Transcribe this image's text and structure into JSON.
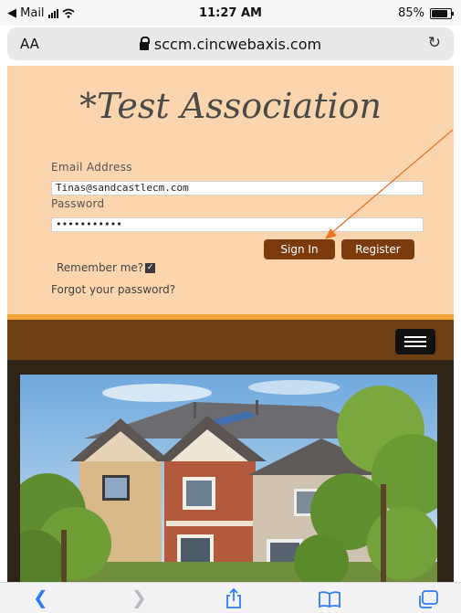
{
  "status_bar": {
    "back_app": "◀ Mail",
    "time": "11:27 AM",
    "battery": "85%",
    "battery_level": 0.85
  },
  "address_bar": {
    "text_size_label": "AA",
    "url": "sccm.cincwebaxis.com",
    "reload_icon": "reload-icon"
  },
  "login": {
    "site_title": "*Test Association",
    "email_label": "Email Address",
    "email_value": "Tinas@sandcastlecm.com",
    "password_label": "Password",
    "password_value": "•••••••••••",
    "sign_in_label": "Sign In",
    "register_label": "Register",
    "remember_label": "Remember me?",
    "remember_checked": true,
    "forgot_label": "Forgot your password?"
  },
  "nav": {
    "menu_icon": "hamburger-menu-icon"
  },
  "toolbar": {
    "back_icon": "chevron-left-icon",
    "forward_icon": "chevron-right-icon",
    "share_icon": "share-icon",
    "bookmarks_icon": "book-icon",
    "tabs_icon": "tabs-icon"
  },
  "colors": {
    "page_bg": "#fad5ad",
    "button_bg": "#7b3b0d",
    "nav_bg": "#6e3f13",
    "accent_strip": "#f2a333",
    "annotation_arrow": "#e8742a"
  }
}
